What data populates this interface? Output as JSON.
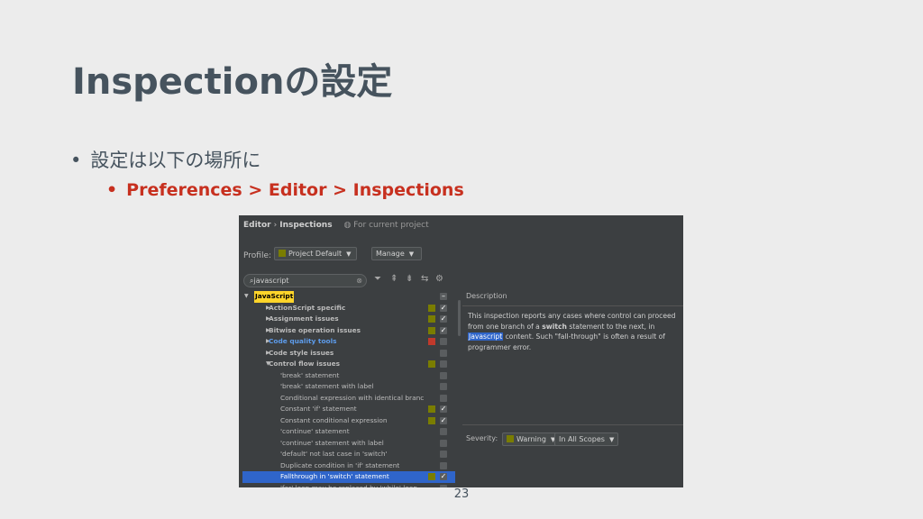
{
  "slide": {
    "title": "Inspectionの設定",
    "bullet1": "設定は以下の場所に",
    "bullet2": "Preferences > Editor > Inspections",
    "page_number": "23"
  },
  "ide": {
    "breadcrumb": {
      "part1": "Editor",
      "separator": "›",
      "part2": "Inspections",
      "project_note": "For current project"
    },
    "profile": {
      "label": "Profile:",
      "value": "Project Default",
      "manage_label": "Manage"
    },
    "search": {
      "value": "javascript"
    },
    "tree": [
      {
        "label": "JavaScript",
        "level": 0,
        "expanded": true,
        "highlight": true
      },
      {
        "label": "ActionScript specific",
        "level": 1,
        "bold": true,
        "severity": "#7a7d00",
        "checked": true
      },
      {
        "label": "Assignment issues",
        "level": 1,
        "bold": true,
        "severity": "#7a7d00",
        "checked": true
      },
      {
        "label": "Bitwise operation issues",
        "level": 1,
        "bold": true,
        "severity": "#7a7d00",
        "checked": true
      },
      {
        "label": "Code quality tools",
        "level": 1,
        "bold": true,
        "blue": true,
        "severity": "#c0392b",
        "checked": false
      },
      {
        "label": "Code style issues",
        "level": 1,
        "bold": true,
        "checked": false
      },
      {
        "label": "Control flow issues",
        "level": 1,
        "bold": true,
        "expanded": true,
        "severity": "#7a7d00",
        "checked": false
      },
      {
        "label": "'break' statement",
        "level": 2,
        "checked": false
      },
      {
        "label": "'break' statement with label",
        "level": 2,
        "checked": false
      },
      {
        "label": "Conditional expression with identical branc",
        "level": 2,
        "checked": false
      },
      {
        "label": "Constant 'if' statement",
        "level": 2,
        "severity": "#7a7d00",
        "checked": true
      },
      {
        "label": "Constant conditional expression",
        "level": 2,
        "severity": "#7a7d00",
        "checked": true
      },
      {
        "label": "'continue' statement",
        "level": 2,
        "checked": false
      },
      {
        "label": "'continue' statement with label",
        "level": 2,
        "checked": false
      },
      {
        "label": "'default' not last case in 'switch'",
        "level": 2,
        "checked": false
      },
      {
        "label": "Duplicate condition in 'if' statement",
        "level": 2,
        "checked": false
      },
      {
        "label": "Fallthrough in 'switch' statement",
        "level": 2,
        "selected": true,
        "severity": "#7a7d00",
        "checked": true
      },
      {
        "label": "'for' loop may be replaced by 'while' loop",
        "level": 2,
        "checked": false
      }
    ],
    "description": {
      "title": "Description",
      "text1": "This inspection reports any cases where control can proceed from one branch of a",
      "keyword": "switch",
      "text2": "statement to the next, in",
      "js": "Javascript",
      "text3": "content. Such \"fall-through\" is often a result of programmer error."
    },
    "severity": {
      "label": "Severity:",
      "value": "Warning",
      "scope": "In All Scopes"
    },
    "colors": {
      "warning": "#7a7d00",
      "error": "#c0392b",
      "selection": "#2f65ca",
      "background": "#3c3f41"
    }
  }
}
